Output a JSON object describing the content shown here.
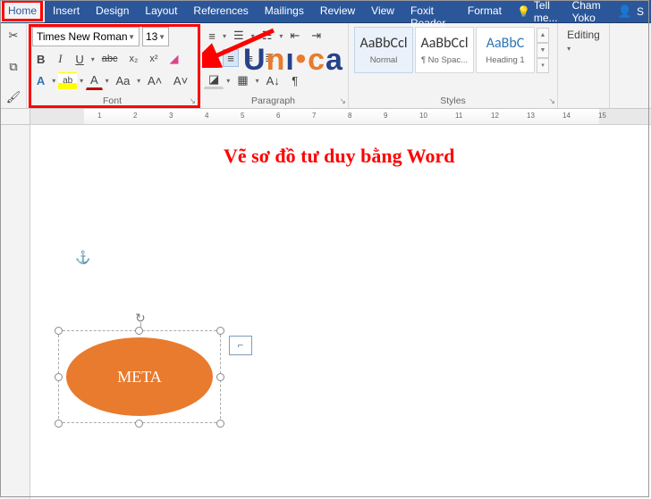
{
  "tabs": {
    "home": "Home",
    "insert": "Insert",
    "design": "Design",
    "layout": "Layout",
    "references": "References",
    "mailings": "Mailings",
    "review": "Review",
    "view": "View",
    "foxit": "Foxit Reader P",
    "format": "Format",
    "tellme": "Tell me..."
  },
  "user": {
    "name": "Cham Yoko"
  },
  "font": {
    "name": "Times New Roman",
    "size": "13",
    "bold": "B",
    "italic": "I",
    "underline": "U",
    "strike": "abc",
    "sub": "x₂",
    "sup": "x²",
    "eraser": "◧",
    "highlight": "ab",
    "color": "A",
    "case": "Aa",
    "grow": "A˄",
    "shrink": "A˅",
    "group_label": "Font"
  },
  "para": {
    "group_label": "Paragraph"
  },
  "styles": {
    "normal_sample": "AaBbCcl",
    "normal_label": "Normal",
    "nospac_sample": "AaBbCcl",
    "nospac_label": "¶ No Spac...",
    "heading_sample": "AaBbC",
    "heading_label": "Heading 1",
    "group_label": "Styles"
  },
  "editing": {
    "label": "Editing"
  },
  "ruler": {
    "marks": [
      "1",
      "2",
      "3",
      "4",
      "5",
      "6",
      "7",
      "8",
      "9",
      "10",
      "11",
      "12",
      "13",
      "14",
      "15"
    ]
  },
  "doc": {
    "title": "Vẽ sơ đồ tư duy bằng Word",
    "shape_text": "META",
    "anchor": "⚓"
  },
  "ui": {
    "dialog_launcher": "↘"
  }
}
